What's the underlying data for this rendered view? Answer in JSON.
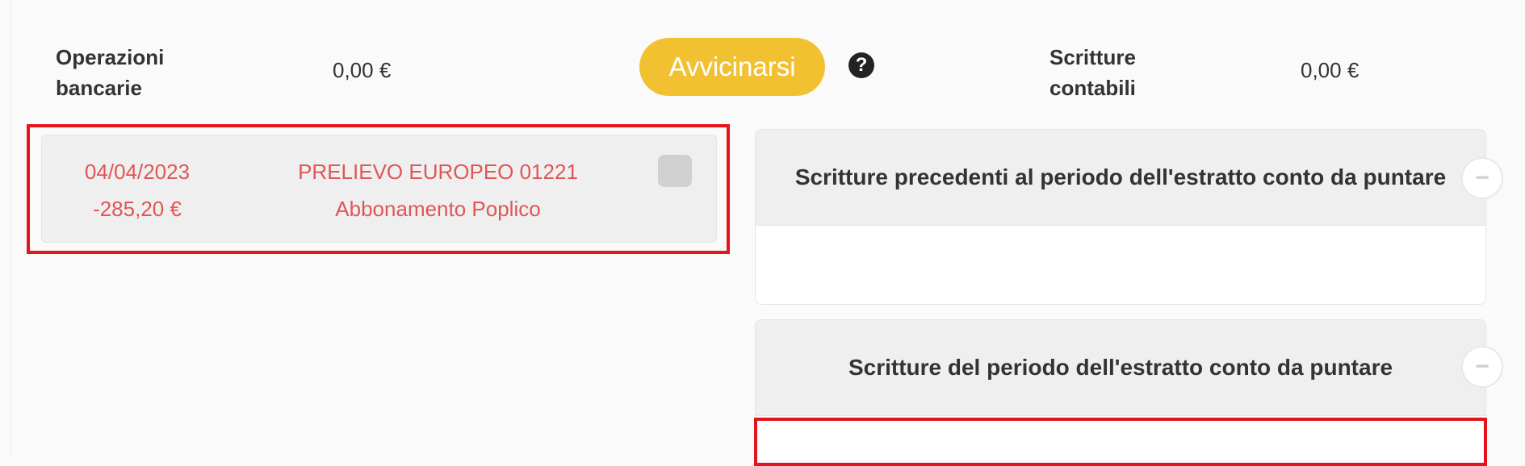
{
  "header": {
    "bank_ops_label_line1": "Operazioni",
    "bank_ops_label_line2": "bancarie",
    "bank_ops_amount": "0,00 €",
    "approach_button": "Avvicinarsi",
    "help_symbol": "?",
    "entries_label_line1": "Scritture",
    "entries_label_line2": "contabili",
    "entries_amount": "0,00 €"
  },
  "transaction": {
    "date": "04/04/2023",
    "amount": "-285,20 €",
    "description_line1": "PRELIEVO EUROPEO 01221",
    "description_line2": "Abbonamento Poplico"
  },
  "panels": [
    {
      "title": "Scritture precedenti al periodo dell'estratto conto da puntare",
      "collapse_symbol": "−"
    },
    {
      "title": "Scritture del periodo dell'estratto conto da puntare",
      "collapse_symbol": "−"
    }
  ],
  "colors": {
    "accent": "#f2c132",
    "highlight": "#e3141c",
    "transaction_text": "#e05656"
  }
}
